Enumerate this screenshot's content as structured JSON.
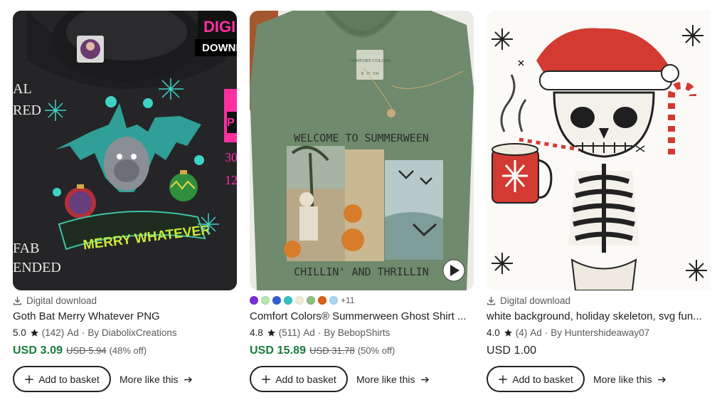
{
  "listings": [
    {
      "badge": "Digital download",
      "title": "Goth Bat Merry Whatever PNG",
      "score": "5.0",
      "reviews": "(142)",
      "ad": "Ad",
      "by": "By DiabolixCreations",
      "price": "USD 3.09",
      "original_price": "USD 5.94",
      "discount": "(48% off)",
      "add_label": "Add to basket",
      "more_label": "More like this",
      "image_text": {
        "banner": "MERRY WHATEVER",
        "left_lines": [
          "AL",
          "RED",
          "FAB",
          "ENDED"
        ],
        "corner_top": "DIGI",
        "corner_download": "DOWNL",
        "right_big": "P",
        "right_nums": [
          "30",
          "12"
        ]
      }
    },
    {
      "title": "Comfort Colors® Summerween Ghost Shirt ...",
      "score": "4.8",
      "reviews": "(511)",
      "ad": "Ad",
      "by": "By BebopShirts",
      "price": "USD 15.89",
      "original_price": "USD 31.78",
      "discount": "(50% off)",
      "swatch_more": "+11",
      "swatch_colors": [
        "#7b2fd6",
        "#b6e7b0",
        "#2f5fd0",
        "#36c3c0",
        "#f0ecd8",
        "#8fbf7f",
        "#d9601a",
        "#a9d6f2"
      ],
      "add_label": "Add to basket",
      "more_label": "More like this",
      "image_text": {
        "top": "WELCOME TO SUMMERWEEN",
        "bottom": "CHILLIN' AND THRILLIN",
        "tag": "COMFORT COLORS",
        "sizes": "S · P · CH"
      }
    },
    {
      "badge": "Digital download",
      "title": "white background, holiday skeleton, svg fun...",
      "score": "4.0",
      "reviews": "(4)",
      "ad": "Ad",
      "by": "By Huntershideaway07",
      "price": "USD 1.00",
      "add_label": "Add to basket",
      "more_label": "More like this"
    }
  ],
  "colors": {
    "sale_price": "#1a7a3e",
    "text": "#222222",
    "muted": "#595959"
  },
  "icons": [
    "download-icon",
    "star-icon",
    "plus-icon",
    "arrow-right-icon",
    "play-icon"
  ]
}
